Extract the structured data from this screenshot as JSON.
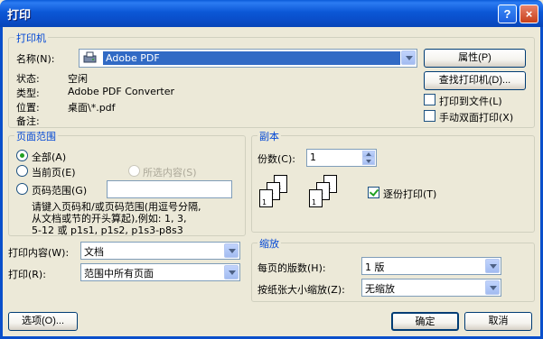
{
  "window": {
    "title": "打印",
    "help_label": "?",
    "close_label": "×"
  },
  "printer": {
    "group_label": "打印机",
    "name_label": "名称(N):",
    "name_value": "Adobe PDF",
    "status_label": "状态:",
    "status_value": "空闲",
    "type_label": "类型:",
    "type_value": "Adobe PDF Converter",
    "where_label": "位置:",
    "where_value": "桌面\\*.pdf",
    "comment_label": "备注:",
    "properties_button": "属性(P)",
    "find_printer_button": "查找打印机(D)...",
    "print_to_file_label": "打印到文件(L)",
    "print_to_file_checked": false,
    "manual_duplex_label": "手动双面打印(X)",
    "manual_duplex_checked": false
  },
  "page_range": {
    "group_label": "页面范围",
    "all_label": "全部(A)",
    "current_label": "当前页(E)",
    "selection_label": "所选内容(S)",
    "pages_label": "页码范围(G)",
    "pages_value": "",
    "selected": "all",
    "hint_line1": "请键入页码和/或页码范围(用逗号分隔,",
    "hint_line2": "从文档或节的开头算起),例如: 1, 3,",
    "hint_line3": "5-12 或 p1s1, p1s2, p1s3-p8s3"
  },
  "copies": {
    "group_label": "副本",
    "count_label": "份数(C):",
    "count_value": "1",
    "collate_label": "逐份打印(T)",
    "collate_checked": true,
    "page_numbers": [
      "1",
      "2",
      "3"
    ]
  },
  "print_what": {
    "label": "打印内容(W):",
    "value": "文档"
  },
  "print_option": {
    "label": "打印(R):",
    "value": "范围中所有页面"
  },
  "zoom": {
    "group_label": "缩放",
    "pages_per_sheet_label": "每页的版数(H):",
    "pages_per_sheet_value": "1 版",
    "scale_label": "按纸张大小缩放(Z):",
    "scale_value": "无缩放"
  },
  "buttons": {
    "options": "选项(O)...",
    "ok": "确定",
    "cancel": "取消"
  }
}
